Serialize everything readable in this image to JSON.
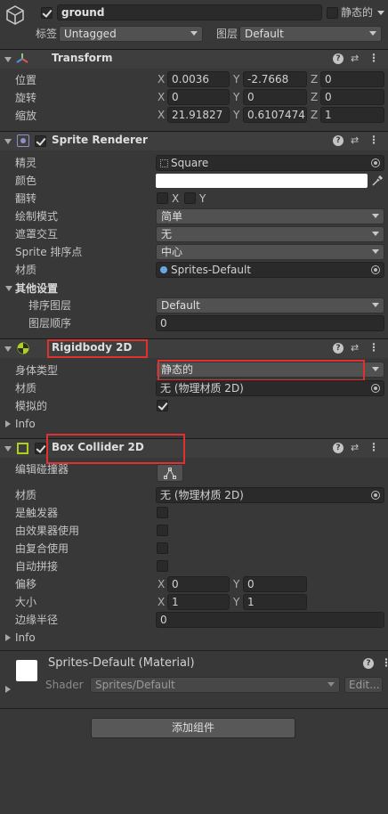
{
  "object": {
    "name": "ground",
    "static_label": "静态的",
    "tag_label": "标签",
    "tag_value": "Untagged",
    "layer_label": "图层",
    "layer_value": "Default"
  },
  "transform": {
    "title": "Transform",
    "position_label": "位置",
    "rotation_label": "旋转",
    "scale_label": "缩放",
    "position": {
      "x": "0.0036",
      "y": "-2.7668",
      "z": "0"
    },
    "rotation": {
      "x": "0",
      "y": "0",
      "z": "0"
    },
    "scale": {
      "x": "21.91827",
      "y": "0.6107474",
      "z": "1"
    }
  },
  "sprite_renderer": {
    "title": "Sprite Renderer",
    "sprite_label": "精灵",
    "sprite_value": "Square",
    "color_label": "颜色",
    "color_value": "#ffffff",
    "flip_label": "翻转",
    "flip_x": "X",
    "flip_y": "Y",
    "draw_mode_label": "绘制模式",
    "draw_mode_value": "简单",
    "mask_label": "遮罩交互",
    "mask_value": "无",
    "sort_point_label": "Sprite 排序点",
    "sort_point_value": "中心",
    "material_label": "材质",
    "material_value": "Sprites-Default",
    "other_settings": "其他设置",
    "sorting_layer_label": "排序图层",
    "sorting_layer_value": "Default",
    "order_label": "图层顺序",
    "order_value": "0"
  },
  "rigidbody": {
    "title": "Rigidbody 2D",
    "body_type_label": "身体类型",
    "body_type_value": "静态的",
    "material_label": "材质",
    "material_value": "无 (物理材质 2D)",
    "simulated_label": "模拟的",
    "info_label": "Info"
  },
  "box_collider": {
    "title": "Box Collider 2D",
    "edit_label": "编辑碰撞器",
    "material_label": "材质",
    "material_value": "无 (物理材质 2D)",
    "trigger_label": "是触发器",
    "effector_label": "由效果器使用",
    "composite_label": "由复合使用",
    "autotile_label": "自动拼接",
    "offset_label": "偏移",
    "offset": {
      "x": "0",
      "y": "0"
    },
    "size_label": "大小",
    "size": {
      "x": "1",
      "y": "1"
    },
    "edge_label": "边缘半径",
    "edge_value": "0",
    "info_label": "Info"
  },
  "material_section": {
    "name": "Sprites-Default (Material)",
    "shader_label": "Shader",
    "shader_value": "Sprites/Default",
    "edit_label": "Edit..."
  },
  "add_component_label": "添加组件",
  "axes": {
    "x": "X",
    "y": "Y",
    "z": "Z"
  },
  "accent_colors": {
    "highlight": "#e03030",
    "background": "#383838"
  }
}
